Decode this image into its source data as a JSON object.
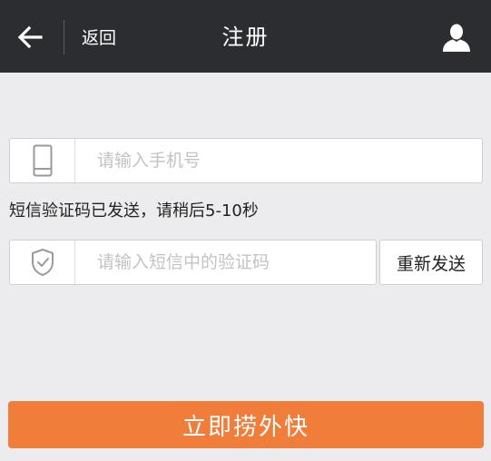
{
  "header": {
    "back_label": "返回",
    "title": "注册",
    "back_icon": "left-arrow-icon",
    "user_icon": "user-icon"
  },
  "form": {
    "phone": {
      "placeholder": "请输入手机号",
      "value": "",
      "icon": "mobile-phone-icon"
    },
    "status_message": "短信验证码已发送，请稍后5-10秒",
    "code": {
      "placeholder": "请输入短信中的验证码",
      "value": "",
      "icon": "shield-check-icon"
    },
    "resend_label": "重新发送",
    "submit_label": "立即捞外快"
  },
  "colors": {
    "header_bg": "#2c2d31",
    "page_bg": "#ececee",
    "accent": "#f17d3a"
  }
}
